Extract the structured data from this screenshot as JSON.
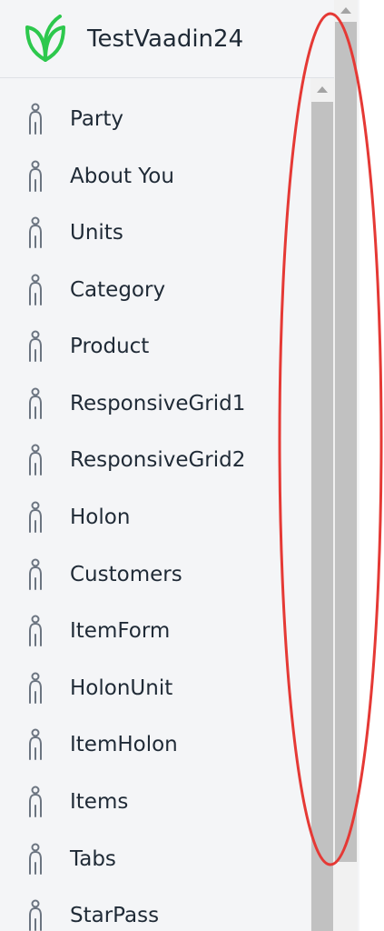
{
  "app": {
    "title": "TestVaadin24",
    "logo_icon": "vaadin-leaf-logo",
    "accent_color": "#2dc84d"
  },
  "nav": {
    "icon": "person-icon",
    "items": [
      {
        "label": "Party"
      },
      {
        "label": "About You"
      },
      {
        "label": "Units"
      },
      {
        "label": "Category"
      },
      {
        "label": "Product"
      },
      {
        "label": "ResponsiveGrid1"
      },
      {
        "label": "ResponsiveGrid2"
      },
      {
        "label": "Holon"
      },
      {
        "label": "Customers"
      },
      {
        "label": "ItemForm"
      },
      {
        "label": "HolonUnit"
      },
      {
        "label": "ItemHolon"
      },
      {
        "label": "Items"
      },
      {
        "label": "Tabs"
      },
      {
        "label": "StarPass"
      }
    ]
  },
  "annotation": {
    "shape": "ellipse",
    "color": "#e53935"
  }
}
